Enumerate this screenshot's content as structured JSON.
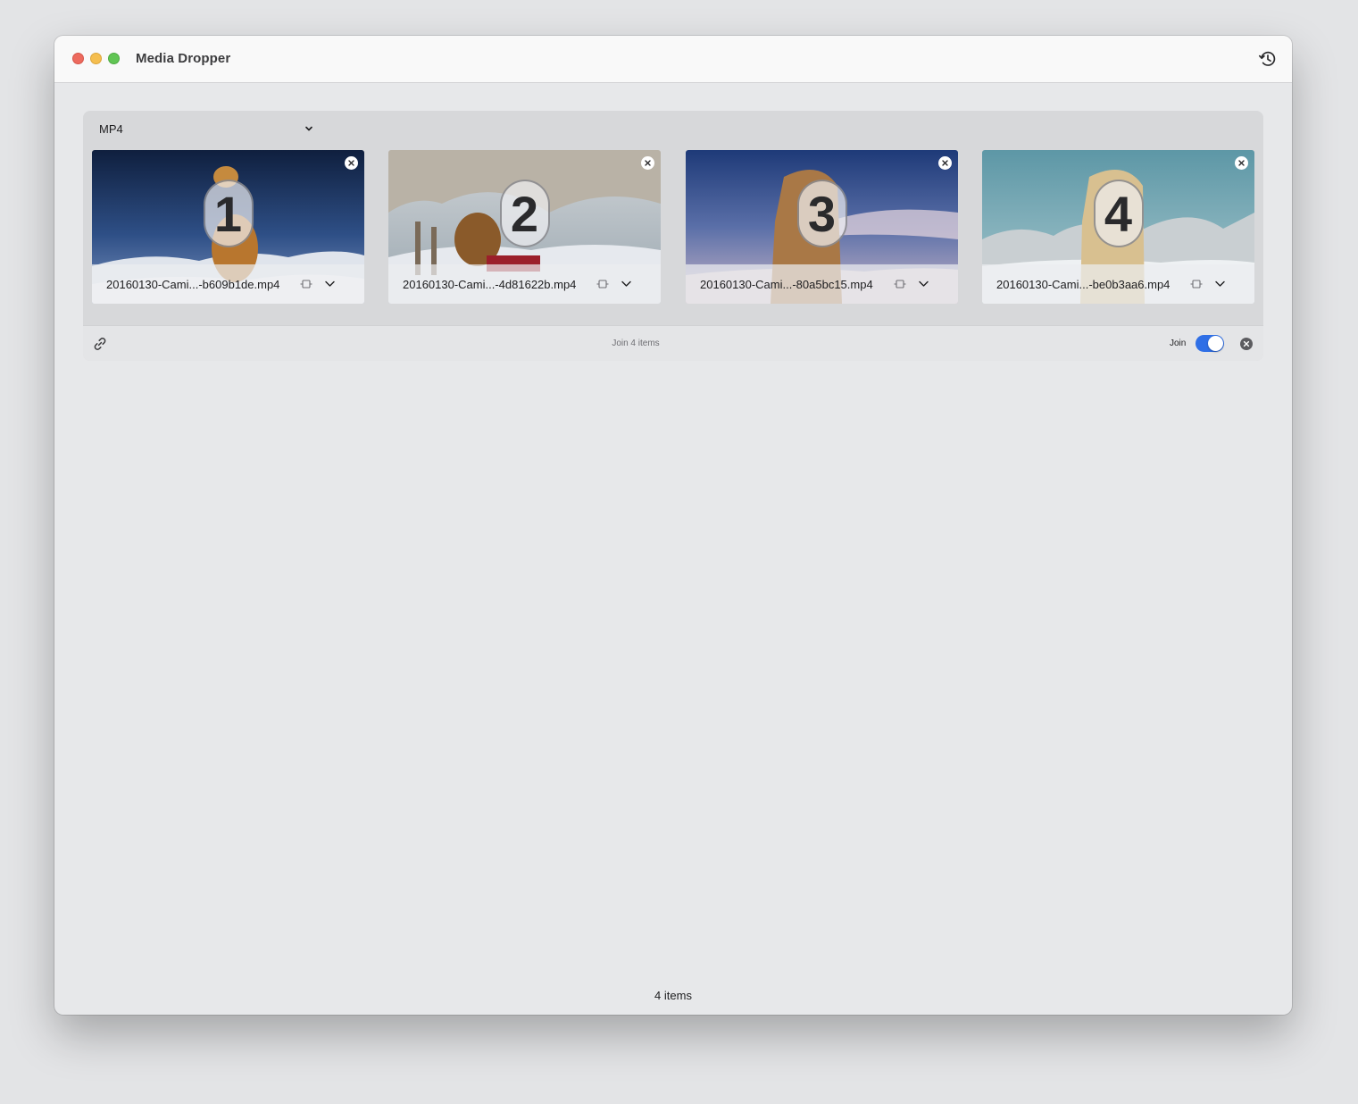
{
  "window": {
    "title": "Media Dropper",
    "history_icon": "history-clock-icon"
  },
  "format": {
    "selected": "MP4"
  },
  "items": [
    {
      "number": "1",
      "filename": "20160130-Cami...-b609b1de.mp4"
    },
    {
      "number": "2",
      "filename": "20160130-Cami...-4d81622b.mp4"
    },
    {
      "number": "3",
      "filename": "20160130-Cami...-80a5bc15.mp4"
    },
    {
      "number": "4",
      "filename": "20160130-Cami...-be0b3aa6.mp4"
    }
  ],
  "group_bar": {
    "status": "Join 4 items",
    "join_label": "Join",
    "join_enabled": true
  },
  "status_bar": {
    "count": "4 items"
  },
  "colors": {
    "accent": "#2f6fe6",
    "window_bg": "#e7e8ea",
    "group_bg": "#d7d8da"
  }
}
